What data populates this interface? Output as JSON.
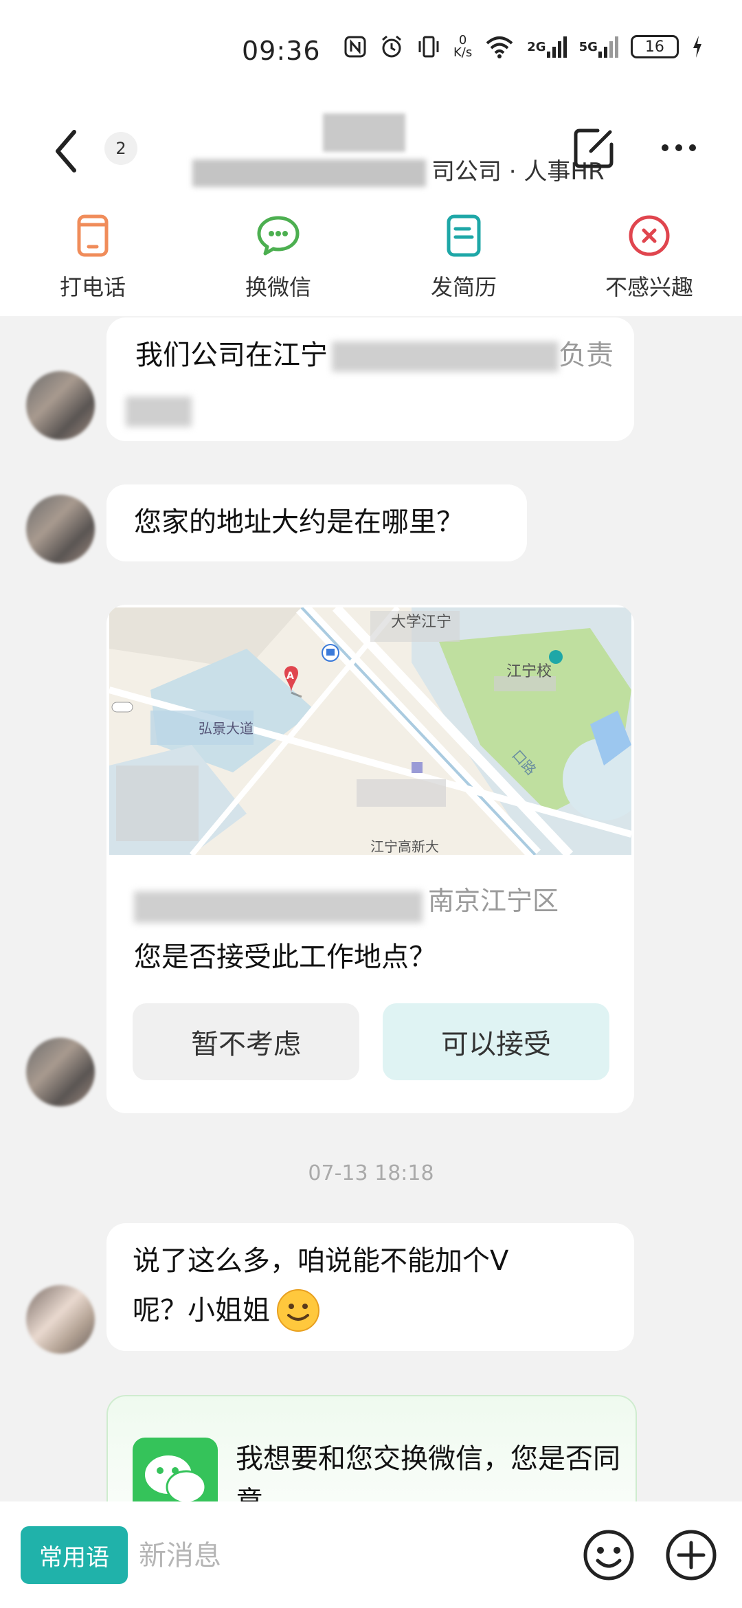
{
  "status_bar": {
    "time": "09:36",
    "net_speed_value": "0",
    "net_speed_unit": "K/s",
    "signal1": "2G",
    "signal2": "5G",
    "battery": "16"
  },
  "header": {
    "back_icon": "chevron-left-icon",
    "badge": "2",
    "subtitle": "司公司 · 人事HR",
    "edit_icon": "edit-icon",
    "more_icon": "more-icon"
  },
  "actions": [
    {
      "label": "打电话",
      "icon": "phone-icon",
      "color": "#f08c5a"
    },
    {
      "label": "换微信",
      "icon": "wechat-icon",
      "color": "#4caf50"
    },
    {
      "label": "发简历",
      "icon": "resume-icon",
      "color": "#1ea7a7"
    },
    {
      "label": "不感兴趣",
      "icon": "not-interested-icon",
      "color": "#e0454e"
    }
  ],
  "messages": {
    "msg1": "我们公司在江宁",
    "msg1_end": "负责",
    "msg2": "您家的地址大约是在哪里？",
    "map_label_1": "大学江宁",
    "map_label_2": "江宁校",
    "map_label_3": "弘景大道",
    "map_label_4": "江宁高新大",
    "map_road": "口路",
    "map_marker": "A",
    "address": "南京江宁区",
    "question": "您是否接受此工作地点？",
    "btn_decline": "暂不考虑",
    "btn_accept": "可以接受",
    "timestamp": "07-13 18:18",
    "msg3_line1": "说了这么多，咱说能不能加个V",
    "msg3_line2": "呢？小姐姐",
    "wechat_card_text": "我想要和您交换微信，您是否同意"
  },
  "bottom_bar": {
    "phrase_button": "常用语",
    "input_placeholder": "新消息",
    "emoji_icon": "emoji-icon",
    "plus_icon": "plus-icon"
  },
  "colors": {
    "accent": "#20b2aa",
    "background": "#f2f2f2",
    "card": "#ffffff"
  }
}
